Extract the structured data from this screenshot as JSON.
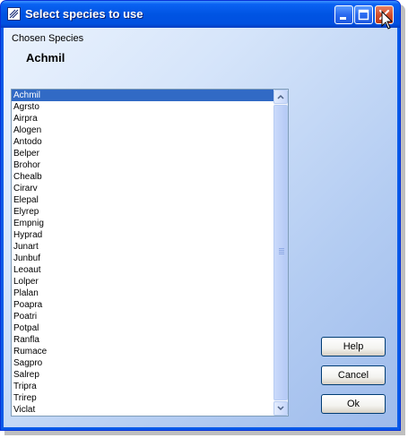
{
  "window": {
    "title": "Select species to use",
    "colors": {
      "titlebar": "#0054e3",
      "selection": "#316ac5",
      "close_button": "#d14d2a"
    }
  },
  "chosen": {
    "label": "Chosen Species",
    "value": "Achmil"
  },
  "species_list": {
    "selected": "Achmil",
    "items": [
      "Achmil",
      "Agrsto",
      "Airpra",
      "Alogen",
      "Antodo",
      "Belper",
      "Brohor",
      "Chealb",
      "Cirarv",
      "Elepal",
      "Elyrep",
      "Empnig",
      "Hyprad",
      "Junart",
      "Junbuf",
      "Leoaut",
      "Lolper",
      "Plalan",
      "Poapra",
      "Poatri",
      "Potpal",
      "Ranfla",
      "Rumace",
      "Sagpro",
      "Salrep",
      "Tripra",
      "Trirep",
      "Viclat"
    ]
  },
  "buttons": {
    "help": "Help",
    "cancel": "Cancel",
    "ok": "Ok"
  },
  "icons": {
    "app": "app-window-icon",
    "minimize": "minimize-icon",
    "maximize": "maximize-icon",
    "close": "close-icon",
    "cursor": "mouse-pointer-icon"
  }
}
